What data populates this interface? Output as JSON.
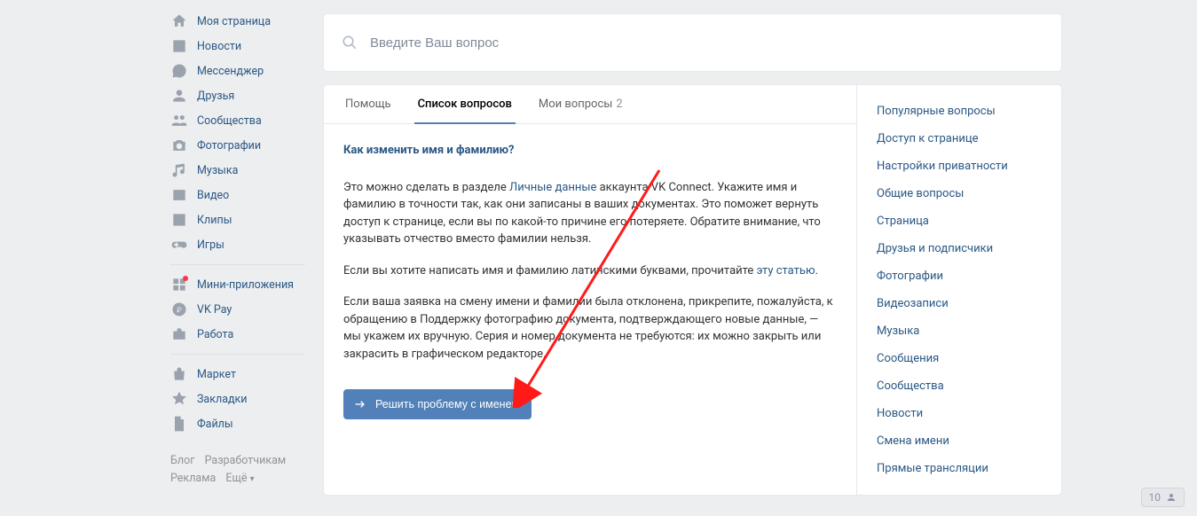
{
  "sidebar": {
    "items": [
      {
        "key": "my-page",
        "label": "Моя страница",
        "icon": "home"
      },
      {
        "key": "news",
        "label": "Новости",
        "icon": "news"
      },
      {
        "key": "messenger",
        "label": "Мессенджер",
        "icon": "chat"
      },
      {
        "key": "friends",
        "label": "Друзья",
        "icon": "person"
      },
      {
        "key": "communities",
        "label": "Сообщества",
        "icon": "group"
      },
      {
        "key": "photos",
        "label": "Фотографии",
        "icon": "camera"
      },
      {
        "key": "music",
        "label": "Музыка",
        "icon": "music"
      },
      {
        "key": "video",
        "label": "Видео",
        "icon": "video"
      },
      {
        "key": "clips",
        "label": "Клипы",
        "icon": "clips"
      },
      {
        "key": "games",
        "label": "Игры",
        "icon": "game"
      }
    ],
    "items2": [
      {
        "key": "mini-apps",
        "label": "Мини-приложения",
        "icon": "apps",
        "dot": true
      },
      {
        "key": "vk-pay",
        "label": "VK Pay",
        "icon": "pay"
      },
      {
        "key": "work",
        "label": "Работа",
        "icon": "work"
      }
    ],
    "items3": [
      {
        "key": "market",
        "label": "Маркет",
        "icon": "market"
      },
      {
        "key": "bookmarks",
        "label": "Закладки",
        "icon": "star"
      },
      {
        "key": "files",
        "label": "Файлы",
        "icon": "doc"
      }
    ],
    "footer": {
      "blog": "Блог",
      "devs": "Разработчикам",
      "ads": "Реклама",
      "more": "Ещё"
    }
  },
  "search": {
    "placeholder": "Введите Ваш вопрос"
  },
  "tabs": [
    {
      "key": "help",
      "label": "Помощь",
      "count": null,
      "active": false
    },
    {
      "key": "faq-list",
      "label": "Список вопросов",
      "count": null,
      "active": true
    },
    {
      "key": "my-questions",
      "label": "Мои вопросы",
      "count": "2",
      "active": false
    }
  ],
  "article": {
    "title": "Как изменить имя и фамилию?",
    "p1_a": "Это можно сделать в разделе ",
    "p1_link": "Личные данные",
    "p1_b": " аккаунта VK Connect. Укажите имя и фамилию в точности так, как они записаны в ваших документах. Это поможет вернуть доступ к странице, если вы по какой-то причине его потеряете. Обратите внимание, что указывать отчество вместо фамилии нельзя.",
    "p2_a": "Если вы хотите написать имя и фамилию латинскими буквами, прочитайте ",
    "p2_link": "эту статью",
    "p2_b": ".",
    "p3": "Если ваша заявка на смену имени и фамилии была отклонена, прикрепите, пожалуйста, к обращению в Поддержку фотографию документа, подтверждающего новые данные, — мы укажем их вручную. Серия и номер документа не требуются: их можно закрыть или закрасить в графическом редакторе.",
    "button": "Решить проблему с именем"
  },
  "topics": [
    "Популярные вопросы",
    "Доступ к странице",
    "Настройки приватности",
    "Общие вопросы",
    "Страница",
    "Друзья и подписчики",
    "Фотографии",
    "Видеозаписи",
    "Музыка",
    "Сообщения",
    "Сообщества",
    "Новости",
    "Смена имени",
    "Прямые трансляции"
  ],
  "counter": {
    "value": "10"
  }
}
